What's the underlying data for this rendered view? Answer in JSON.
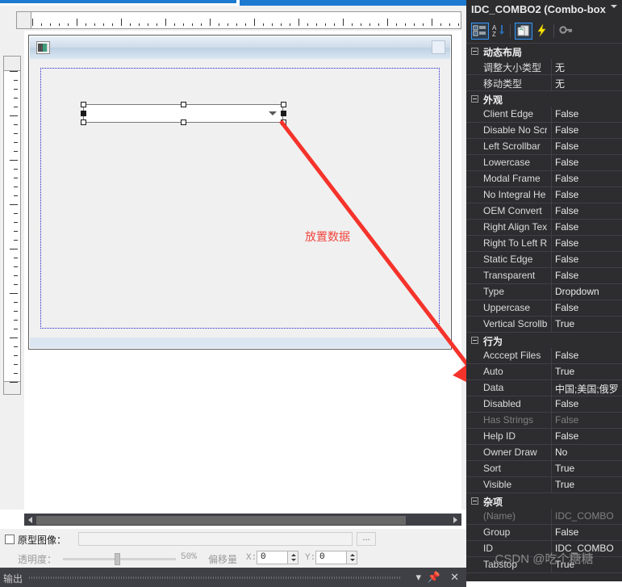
{
  "designer": {
    "dialog_icon": "dialog-window-icon",
    "combo_control": "IDC_COMBO2",
    "annotation_text": "放置数据",
    "prototype": {
      "checkbox_label": "原型图像：",
      "path_value": "",
      "browse_label": "...",
      "opacity_label": "透明度：",
      "opacity_percent": "50%",
      "offset_label": "偏移量",
      "offset_x_label": "X:",
      "offset_x_value": "0",
      "offset_y_label": "Y:",
      "offset_y_value": "0"
    },
    "output_panel": {
      "title": "输出",
      "dropdown_icon": "chevron-down-icon",
      "pin_icon": "pin-icon",
      "close_icon": "close-icon"
    }
  },
  "properties_panel": {
    "title": "IDC_COMBO2 (Combo-box",
    "title_chevron": "chevron-down-icon",
    "toolbar": [
      {
        "name": "categorized-view-icon",
        "active": true
      },
      {
        "name": "alphabetical-sort-icon",
        "active": false
      },
      {
        "name": "property-pages-icon",
        "active": true
      },
      {
        "name": "events-lightning-icon",
        "active": false
      },
      {
        "name": "key-icon",
        "active": false
      }
    ],
    "categories": [
      {
        "name": "动态布局",
        "rows": [
          {
            "key": "调整大小类型",
            "value": "无",
            "dim": false
          },
          {
            "key": "移动类型",
            "value": "无",
            "dim": false
          }
        ]
      },
      {
        "name": "外观",
        "rows": [
          {
            "key": "Client Edge",
            "value": "False",
            "dim": false
          },
          {
            "key": "Disable No Scr",
            "value": "False",
            "dim": false
          },
          {
            "key": "Left Scrollbar",
            "value": "False",
            "dim": false
          },
          {
            "key": "Lowercase",
            "value": "False",
            "dim": false
          },
          {
            "key": "Modal Frame",
            "value": "False",
            "dim": false
          },
          {
            "key": "No Integral He",
            "value": "False",
            "dim": false
          },
          {
            "key": "OEM Convert",
            "value": "False",
            "dim": false
          },
          {
            "key": "Right Align Tex",
            "value": "False",
            "dim": false
          },
          {
            "key": "Right To Left R",
            "value": "False",
            "dim": false
          },
          {
            "key": "Static Edge",
            "value": "False",
            "dim": false
          },
          {
            "key": "Transparent",
            "value": "False",
            "dim": false
          },
          {
            "key": "Type",
            "value": "Dropdown",
            "dim": false
          },
          {
            "key": "Uppercase",
            "value": "False",
            "dim": false
          },
          {
            "key": "Vertical Scrollb",
            "value": "True",
            "dim": false
          }
        ]
      },
      {
        "name": "行为",
        "rows": [
          {
            "key": "Acccept Files",
            "value": "False",
            "dim": false
          },
          {
            "key": "Auto",
            "value": "True",
            "dim": false
          },
          {
            "key": "Data",
            "value": "中国;美国;俄罗",
            "dim": false
          },
          {
            "key": "Disabled",
            "value": "False",
            "dim": false
          },
          {
            "key": "Has Strings",
            "value": "False",
            "dim": true
          },
          {
            "key": "Help ID",
            "value": "False",
            "dim": false
          },
          {
            "key": "Owner Draw",
            "value": "No",
            "dim": false
          },
          {
            "key": "Sort",
            "value": "True",
            "dim": false
          },
          {
            "key": "Visible",
            "value": "True",
            "dim": false
          }
        ]
      },
      {
        "name": "杂项",
        "rows": [
          {
            "key": "(Name)",
            "value": "IDC_COMBO",
            "dim": true
          },
          {
            "key": "Group",
            "value": "False",
            "dim": false
          },
          {
            "key": "ID",
            "value": "IDC_COMBO",
            "dim": false
          },
          {
            "key": "Tabstop",
            "value": "True",
            "dim": false
          }
        ]
      }
    ],
    "watermark": "CSDN @吃个糖糖"
  },
  "colors": {
    "accent_blue": "#1c7ad1",
    "panel_dark": "#2d2d30",
    "annotation_red": "#f0453d",
    "highlight_blue": "#3399ff"
  }
}
